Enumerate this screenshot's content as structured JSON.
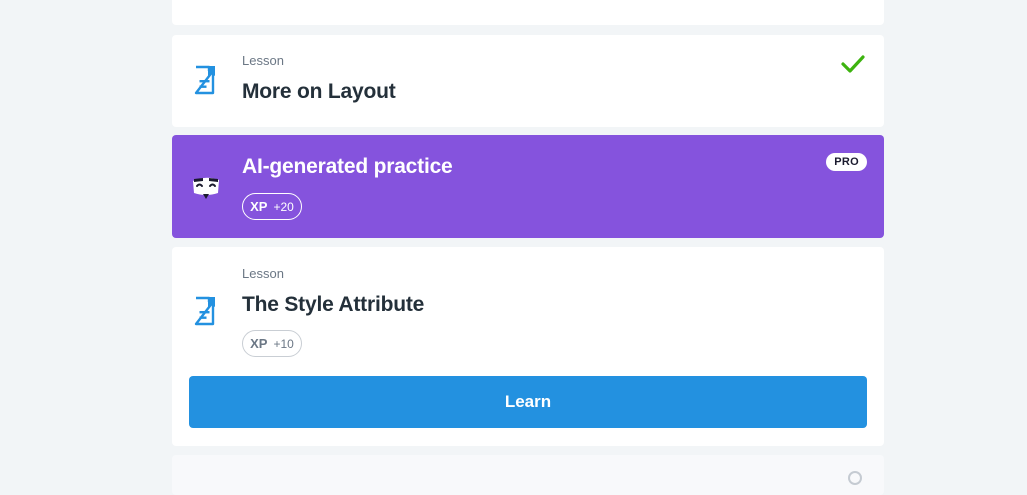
{
  "lessons": [
    {
      "kind": "",
      "title": "",
      "partially_visible": true
    },
    {
      "kind": "Lesson",
      "title": "More on Layout",
      "completed": true,
      "icon": "document-icon"
    },
    {
      "kind": "",
      "title": "AI-generated practice",
      "badge": "PRO",
      "xp_tag": "XP",
      "xp_value": "+20",
      "icon": "ai-bot-icon"
    },
    {
      "kind": "Lesson",
      "title": "The Style Attribute",
      "xp_tag": "XP",
      "xp_value": "+10",
      "icon": "document-icon",
      "action_label": "Learn"
    }
  ],
  "colors": {
    "background": "#f2f5f7",
    "card": "#ffffff",
    "ai_card": "#8553dd",
    "primary": "#2391e0",
    "check": "#3db30f",
    "text": "#24303a",
    "muted": "#6b7785"
  }
}
